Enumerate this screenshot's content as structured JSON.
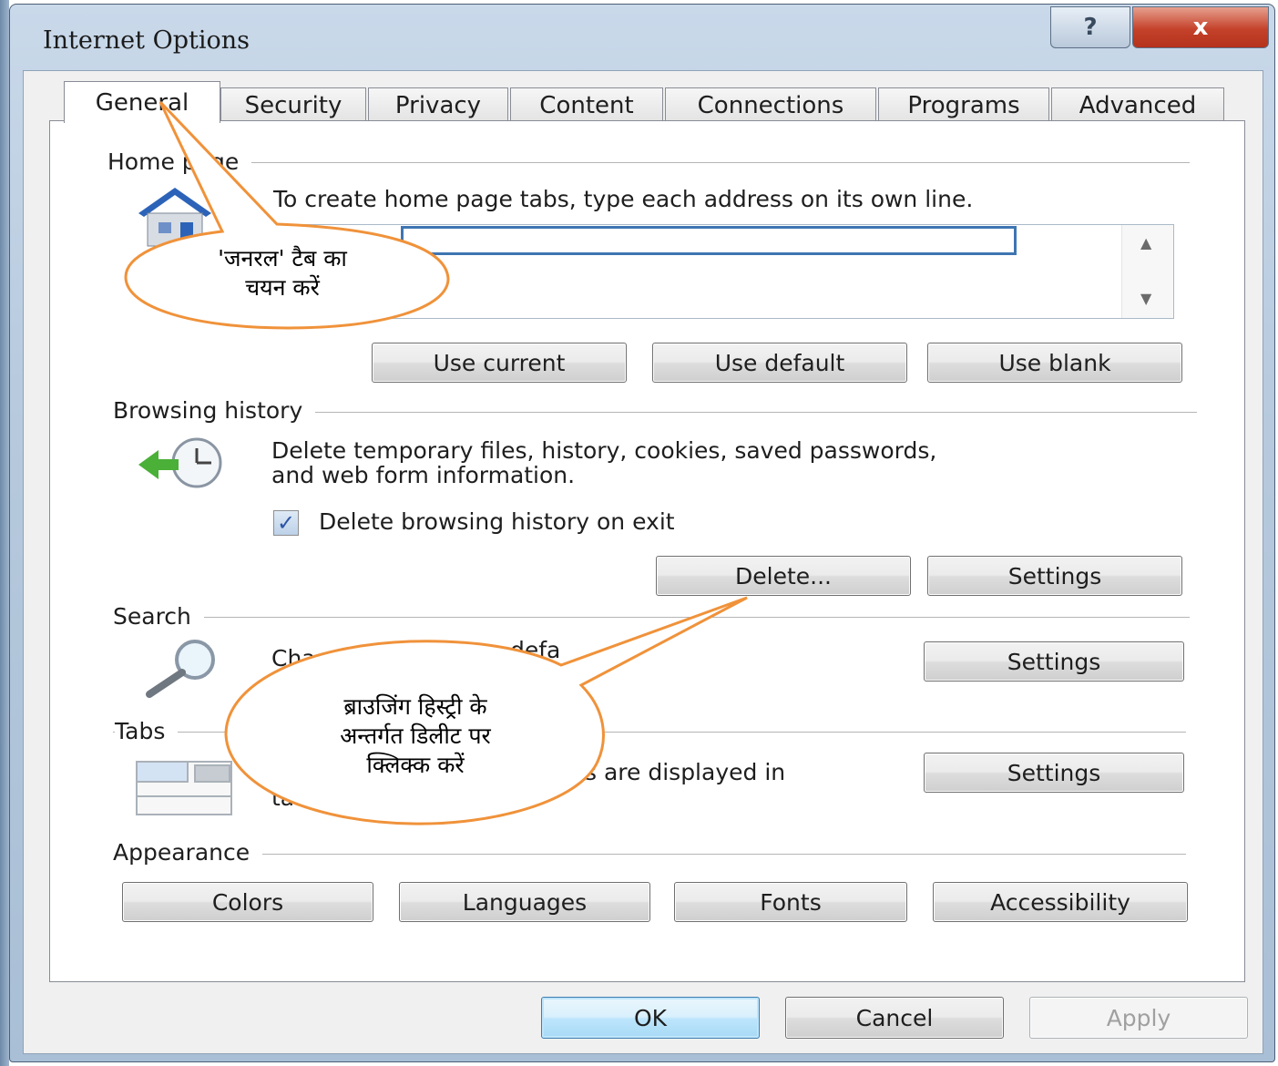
{
  "window": {
    "title": "Internet Options",
    "help_label": "?",
    "close_label": "x"
  },
  "tabs": [
    "General",
    "Security",
    "Privacy",
    "Content",
    "Connections",
    "Programs",
    "Advanced"
  ],
  "active_tab": "General",
  "home_page": {
    "heading": "Home page",
    "description": "To create home page tabs, type each address on its own line.",
    "url_value": "",
    "buttons": [
      "Use current",
      "Use default",
      "Use blank"
    ]
  },
  "browsing_history": {
    "heading": "Browsing history",
    "description_line1": "Delete temporary files, history, cookies, saved passwords,",
    "description_line2": "and web form information.",
    "checkbox_label": "Delete browsing history on exit",
    "checkbox_checked": true,
    "delete_label": "Delete...",
    "settings_label": "Settings"
  },
  "search": {
    "heading": "Search",
    "description_partial": "Cha",
    "description_partial2": "defa",
    "settings_label": "Settings"
  },
  "tabs_section": {
    "heading": "Tabs",
    "description_partial": "s are displayed in",
    "description_partial2": "ta",
    "settings_label": "Settings"
  },
  "appearance": {
    "heading": "Appearance",
    "buttons": [
      "Colors",
      "Languages",
      "Fonts",
      "Accessibility"
    ]
  },
  "footer": {
    "ok": "OK",
    "cancel": "Cancel",
    "apply": "Apply"
  },
  "callouts": {
    "general_line1": "'जनरल' टैब का",
    "general_line2": "चयन करें",
    "delete_line1": "ब्राउजिंग हिस्ट्री के",
    "delete_line2": "अन्तर्गत डिलीट पर",
    "delete_line3": "क्लिक्क करें",
    "color": "#f0923a"
  }
}
